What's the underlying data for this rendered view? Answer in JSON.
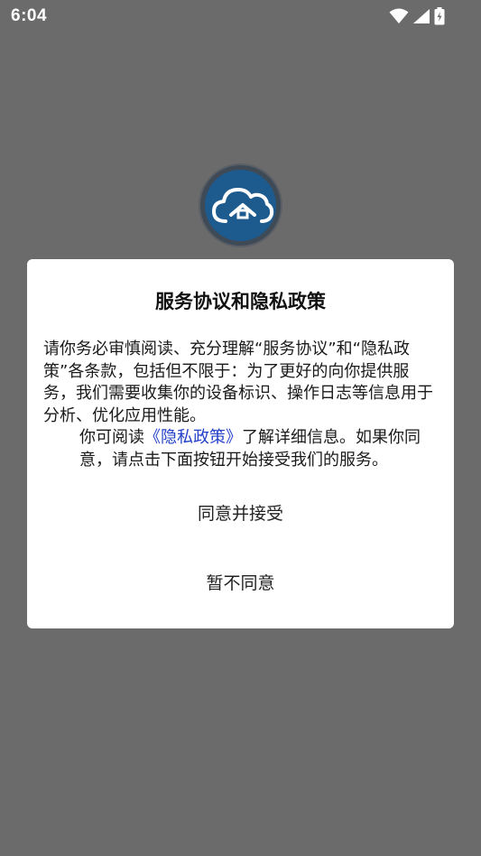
{
  "status_bar": {
    "time": "6:04",
    "icons": [
      "wifi-icon",
      "cellular-signal-icon",
      "battery-charging-icon"
    ]
  },
  "app": {
    "logo_icon": "cloud-house-logo",
    "logo_colors": {
      "circle": "#1d5a8e",
      "outline": "#3f4a57",
      "glyph": "#ffffff"
    }
  },
  "dialog": {
    "title": "服务协议和隐私政策",
    "paragraph1": "请你务必审慎阅读、充分理解“服务协议”和“隐私政策”各条款，包括但不限于：为了更好的向你提供服务，我们需要收集你的设备标识、操作日志等信息用于分析、优化应用性能。",
    "paragraph2_before": "你可阅读",
    "privacy_link": "《隐私政策》",
    "paragraph2_after": "了解详细信息。如果你同意，请点击下面按钮开始接受我们的服务。",
    "accept_label": "同意并接受",
    "decline_label": "暂不同意",
    "link_color": "#2340c8"
  }
}
